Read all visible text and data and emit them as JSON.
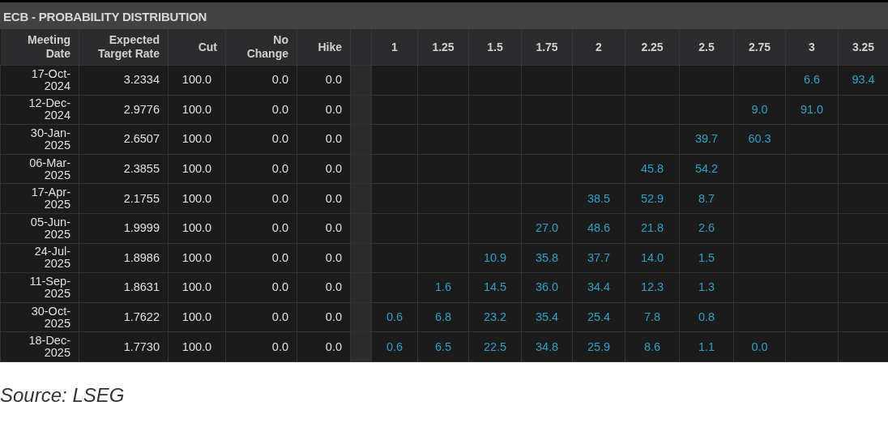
{
  "panel": {
    "title": "ECB - PROBABILITY DISTRIBUTION"
  },
  "table": {
    "columns": [
      "Meeting Date",
      "Expected Target Rate",
      "Cut",
      "No Change",
      "Hike"
    ],
    "rate_columns": [
      "1",
      "1.25",
      "1.5",
      "1.75",
      "2",
      "2.25",
      "2.5",
      "2.75",
      "3",
      "3.25"
    ],
    "rows": [
      {
        "date": "17-Oct-2024",
        "expected": "3.2334",
        "cut": "100.0",
        "no_change": "0.0",
        "hike": "0.0",
        "probabilities": [
          {
            "kind": "empty"
          },
          {
            "kind": "empty"
          },
          {
            "kind": "empty"
          },
          {
            "kind": "empty"
          },
          {
            "kind": "empty"
          },
          {
            "kind": "empty"
          },
          {
            "kind": "empty"
          },
          {
            "kind": "empty"
          },
          {
            "kind": "value",
            "value": "6.6"
          },
          {
            "kind": "value",
            "value": "93.4"
          }
        ]
      },
      {
        "date": "12-Dec-2024",
        "expected": "2.9776",
        "cut": "100.0",
        "no_change": "0.0",
        "hike": "0.0",
        "probabilities": [
          {
            "kind": "empty"
          },
          {
            "kind": "empty"
          },
          {
            "kind": "empty"
          },
          {
            "kind": "empty"
          },
          {
            "kind": "empty"
          },
          {
            "kind": "empty"
          },
          {
            "kind": "empty"
          },
          {
            "kind": "value",
            "value": "9.0"
          },
          {
            "kind": "value",
            "value": "91.0"
          },
          {
            "kind": "empty"
          }
        ]
      },
      {
        "date": "30-Jan-2025",
        "expected": "2.6507",
        "cut": "100.0",
        "no_change": "0.0",
        "hike": "0.0",
        "probabilities": [
          {
            "kind": "empty"
          },
          {
            "kind": "empty"
          },
          {
            "kind": "empty"
          },
          {
            "kind": "empty"
          },
          {
            "kind": "empty"
          },
          {
            "kind": "empty"
          },
          {
            "kind": "value",
            "value": "39.7"
          },
          {
            "kind": "value",
            "value": "60.3"
          },
          {
            "kind": "empty"
          },
          {
            "kind": "empty"
          }
        ]
      },
      {
        "date": "06-Mar-2025",
        "expected": "2.3855",
        "cut": "100.0",
        "no_change": "0.0",
        "hike": "0.0",
        "probabilities": [
          {
            "kind": "empty"
          },
          {
            "kind": "empty"
          },
          {
            "kind": "empty"
          },
          {
            "kind": "empty"
          },
          {
            "kind": "empty"
          },
          {
            "kind": "value",
            "value": "45.8"
          },
          {
            "kind": "value",
            "value": "54.2"
          },
          {
            "kind": "empty"
          },
          {
            "kind": "empty"
          },
          {
            "kind": "empty"
          }
        ]
      },
      {
        "date": "17-Apr-2025",
        "expected": "2.1755",
        "cut": "100.0",
        "no_change": "0.0",
        "hike": "0.0",
        "probabilities": [
          {
            "kind": "empty"
          },
          {
            "kind": "empty"
          },
          {
            "kind": "empty"
          },
          {
            "kind": "empty"
          },
          {
            "kind": "value",
            "value": "38.5"
          },
          {
            "kind": "value",
            "value": "52.9"
          },
          {
            "kind": "value",
            "value": "8.7"
          },
          {
            "kind": "empty"
          },
          {
            "kind": "empty"
          },
          {
            "kind": "empty"
          }
        ]
      },
      {
        "date": "05-Jun-2025",
        "expected": "1.9999",
        "cut": "100.0",
        "no_change": "0.0",
        "hike": "0.0",
        "probabilities": [
          {
            "kind": "empty"
          },
          {
            "kind": "empty"
          },
          {
            "kind": "empty"
          },
          {
            "kind": "value",
            "value": "27.0"
          },
          {
            "kind": "value",
            "value": "48.6"
          },
          {
            "kind": "value",
            "value": "21.8"
          },
          {
            "kind": "value",
            "value": "2.6"
          },
          {
            "kind": "empty"
          },
          {
            "kind": "empty"
          },
          {
            "kind": "empty"
          }
        ]
      },
      {
        "date": "24-Jul-2025",
        "expected": "1.8986",
        "cut": "100.0",
        "no_change": "0.0",
        "hike": "0.0",
        "probabilities": [
          {
            "kind": "empty"
          },
          {
            "kind": "empty"
          },
          {
            "kind": "value",
            "value": "10.9"
          },
          {
            "kind": "value",
            "value": "35.8"
          },
          {
            "kind": "value",
            "value": "37.7"
          },
          {
            "kind": "value",
            "value": "14.0"
          },
          {
            "kind": "value",
            "value": "1.5"
          },
          {
            "kind": "empty"
          },
          {
            "kind": "empty"
          },
          {
            "kind": "empty"
          }
        ]
      },
      {
        "date": "11-Sep-2025",
        "expected": "1.8631",
        "cut": "100.0",
        "no_change": "0.0",
        "hike": "0.0",
        "probabilities": [
          {
            "kind": "empty"
          },
          {
            "kind": "value",
            "value": "1.6"
          },
          {
            "kind": "value",
            "value": "14.5"
          },
          {
            "kind": "value",
            "value": "36.0"
          },
          {
            "kind": "value",
            "value": "34.4"
          },
          {
            "kind": "value",
            "value": "12.3"
          },
          {
            "kind": "value",
            "value": "1.3"
          },
          {
            "kind": "empty"
          },
          {
            "kind": "empty"
          },
          {
            "kind": "empty"
          }
        ]
      },
      {
        "date": "30-Oct-2025",
        "expected": "1.7622",
        "cut": "100.0",
        "no_change": "0.0",
        "hike": "0.0",
        "probabilities": [
          {
            "kind": "value",
            "value": "0.6"
          },
          {
            "kind": "value",
            "value": "6.8"
          },
          {
            "kind": "value",
            "value": "23.2"
          },
          {
            "kind": "value",
            "value": "35.4"
          },
          {
            "kind": "value",
            "value": "25.4"
          },
          {
            "kind": "value",
            "value": "7.8"
          },
          {
            "kind": "value",
            "value": "0.8"
          },
          {
            "kind": "empty"
          },
          {
            "kind": "empty"
          },
          {
            "kind": "empty"
          }
        ]
      },
      {
        "date": "18-Dec-2025",
        "expected": "1.7730",
        "cut": "100.0",
        "no_change": "0.0",
        "hike": "0.0",
        "probabilities": [
          {
            "kind": "value",
            "value": "0.6"
          },
          {
            "kind": "value",
            "value": "6.5"
          },
          {
            "kind": "value",
            "value": "22.5"
          },
          {
            "kind": "value",
            "value": "34.8"
          },
          {
            "kind": "value",
            "value": "25.9"
          },
          {
            "kind": "value",
            "value": "8.6"
          },
          {
            "kind": "value",
            "value": "1.1"
          },
          {
            "kind": "value",
            "value": "0.0"
          },
          {
            "kind": "empty"
          },
          {
            "kind": "empty"
          }
        ]
      }
    ]
  },
  "caption": "Source: LSEG"
}
